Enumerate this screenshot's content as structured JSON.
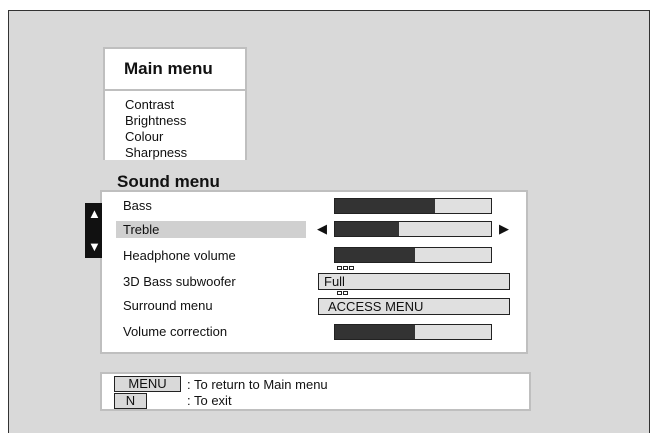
{
  "main_menu": {
    "title": "Main menu",
    "items": [
      "Contrast",
      "Brightness",
      "Colour",
      "Sharpness"
    ]
  },
  "sound_menu": {
    "title": "Sound menu",
    "side_arrows": {
      "up": "▲",
      "down": "▼"
    },
    "rows": [
      {
        "label": "Bass",
        "level": 0.64
      },
      {
        "label": "Treble",
        "level": 0.41,
        "selected": true,
        "left_arrow": "◀",
        "right_arrow": "▶"
      },
      {
        "label": "Headphone volume",
        "level": 0.51
      },
      {
        "label": "3D Bass subwoofer",
        "value": "Full"
      },
      {
        "label": "Surround menu",
        "value": "ACCESS MENU"
      },
      {
        "label": "Volume correction",
        "level": 0.51
      }
    ]
  },
  "help": {
    "menu_key": "MENU",
    "menu_text": ": To return to Main menu",
    "exit_key": "N",
    "exit_text": ": To exit"
  },
  "colors": {
    "screen_background": "#d9d9d9",
    "panel_background": "#ffffff",
    "bar_fill": "#333333",
    "selection_highlight": "#d0d0d0"
  }
}
